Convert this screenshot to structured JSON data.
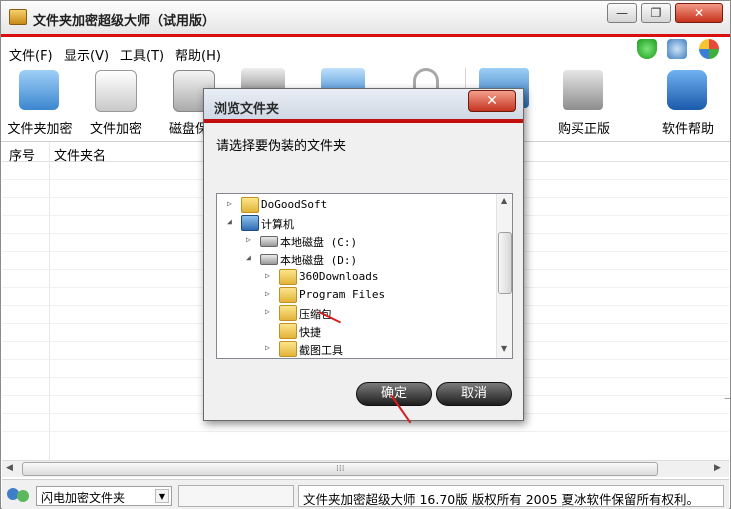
{
  "window": {
    "title": "文件夹加密超级大师（试用版）",
    "controls": {
      "minimize": "—",
      "maximize": "❐",
      "close": "✕"
    }
  },
  "menu": [
    "文件(F)",
    "显示(V)",
    "工具(T)",
    "帮助(H)"
  ],
  "toolbar": [
    {
      "label": "文件夹加密",
      "icon": "folder-lock-icon"
    },
    {
      "label": "文件加密",
      "icon": "file-lock-icon"
    },
    {
      "label": "磁盘保",
      "icon": "disk-protect-icon"
    },
    {
      "label": "购买正版",
      "icon": "shopping-cart-icon"
    },
    {
      "label": "软件帮助",
      "icon": "help-icon"
    }
  ],
  "list": {
    "columns": [
      "序号",
      "文件夹名"
    ]
  },
  "status": {
    "mode": "闪电加密文件夹",
    "copyright": "文件夹加密超级大师 16.70版 版权所有 2005 夏冰软件保留所有权利。"
  },
  "dialog": {
    "title": "浏览文件夹",
    "close": "✕",
    "prompt": "请选择要伪装的文件夹",
    "tree": [
      {
        "label": "DoGoodSoft",
        "expander": "▷",
        "icon": "user-folder"
      },
      {
        "label": "计算机",
        "expander": "◢",
        "icon": "computer"
      },
      {
        "label": "本地磁盘 (C:)",
        "expander": "▷",
        "icon": "drive"
      },
      {
        "label": "本地磁盘 (D:)",
        "expander": "◢",
        "icon": "drive"
      },
      {
        "label": "360Downloads",
        "expander": "▷",
        "icon": "folder"
      },
      {
        "label": "Program Files",
        "expander": "▷",
        "icon": "folder"
      },
      {
        "label": "压缩包",
        "expander": "▷",
        "icon": "folder"
      },
      {
        "label": "快捷",
        "expander": "",
        "icon": "folder"
      },
      {
        "label": "截图工具",
        "expander": "▷",
        "icon": "folder"
      }
    ],
    "ok": "确定",
    "cancel": "取消"
  },
  "colors": {
    "accent_red": "#d90f0f"
  }
}
